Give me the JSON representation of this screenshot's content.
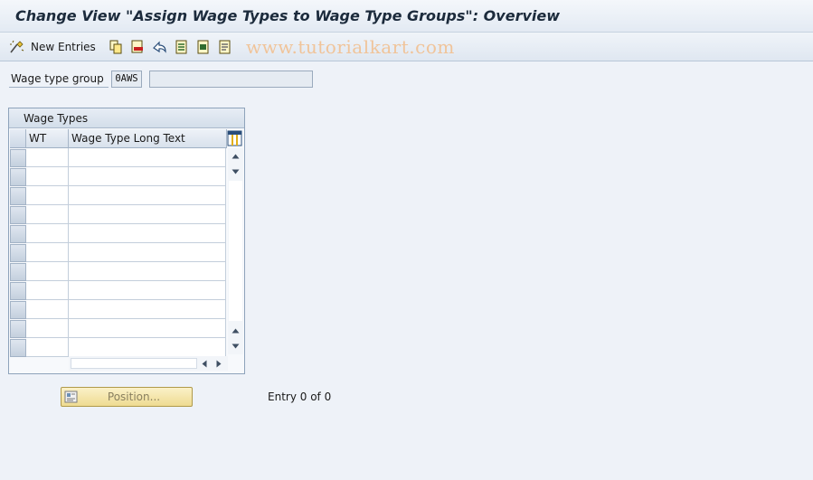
{
  "window": {
    "title": "Change View \"Assign Wage Types to Wage Type Groups\": Overview"
  },
  "toolbar": {
    "new_entries_label": "New Entries",
    "watermark": "www.tutorialkart.com",
    "icons": [
      "new-entries-icon",
      "copy-icon",
      "delete-icon",
      "undo-change-icon",
      "select-all-icon",
      "select-block-icon",
      "deselect-all-icon"
    ]
  },
  "form": {
    "wage_type_group_label": "Wage type group",
    "wage_type_group_value": "0AWS",
    "wage_type_group_description": ""
  },
  "table": {
    "caption": "Wage Types",
    "columns": [
      "WT",
      "Wage Type Long Text"
    ],
    "visible_rows": 11,
    "rows": []
  },
  "footer": {
    "position_button_label": "Position...",
    "entry_count": "Entry 0 of 0"
  },
  "colors": {
    "title_text": "#1c2b3c",
    "background": "#eef2f8",
    "watermark": "#f0c49a",
    "position_button": "#eedb91"
  }
}
